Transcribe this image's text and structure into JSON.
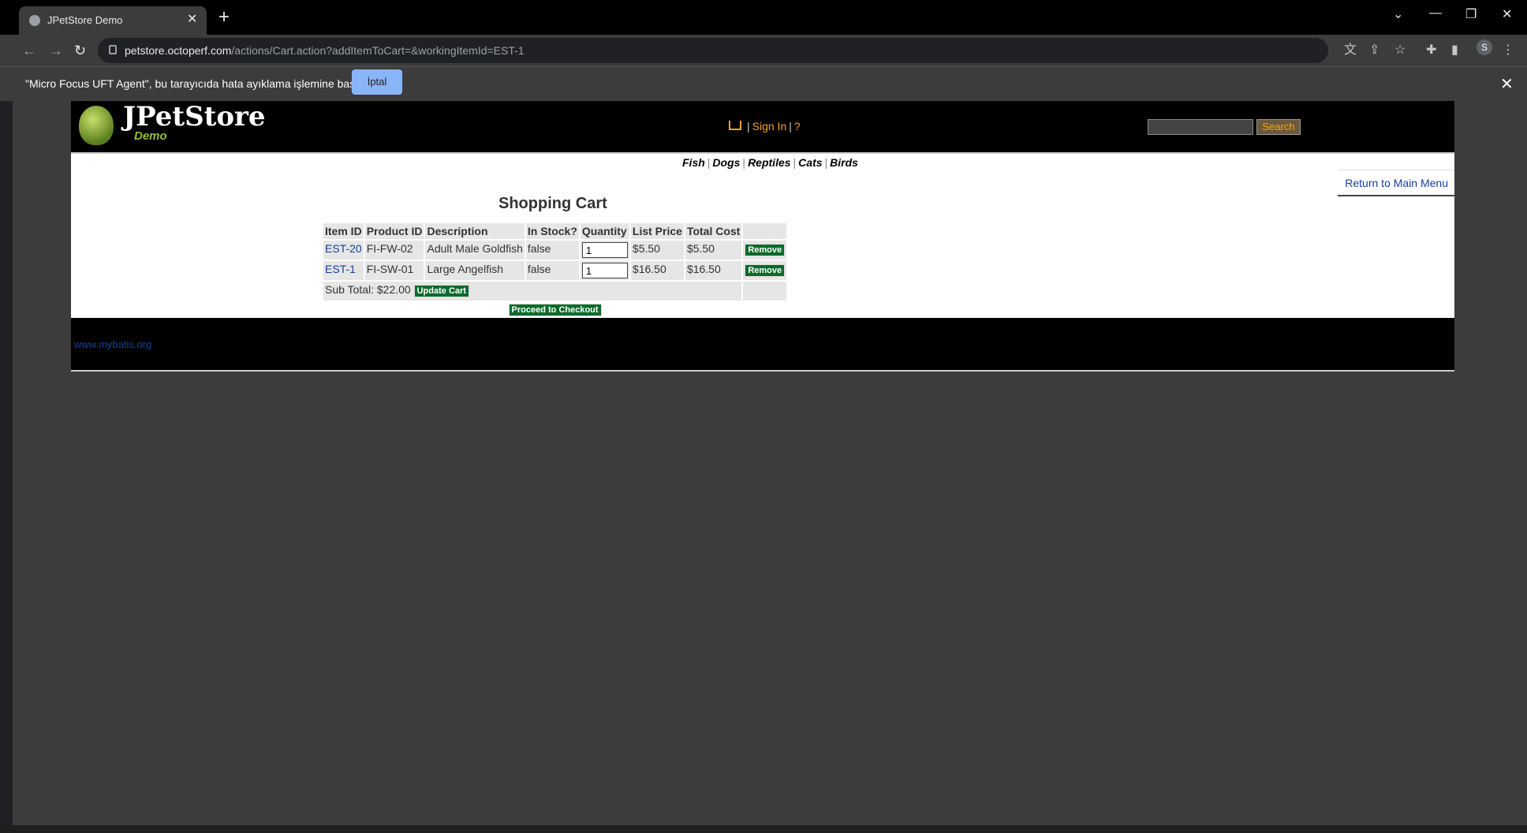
{
  "browser": {
    "tab_title": "JPetStore Demo",
    "url_host": "petstore.octoperf.com",
    "url_path": "/actions/Cart.action?addItemToCart=&workingItemId=EST-1",
    "avatar_letter": "S"
  },
  "infobar": {
    "message": "\"Micro Focus UFT Agent\", bu tarayıcıda hata ayıklama işlemine başladı",
    "cancel_label": "İptal"
  },
  "header": {
    "logo_title": "JPetStore",
    "logo_sub": "Demo",
    "sign_in": "Sign In",
    "help": "?",
    "search_label": "Search"
  },
  "quicklinks": [
    "Fish",
    "Dogs",
    "Reptiles",
    "Cats",
    "Birds"
  ],
  "return_link": "Return to Main Menu",
  "cart": {
    "title": "Shopping Cart",
    "columns": [
      "Item ID",
      "Product ID",
      "Description",
      "In Stock?",
      "Quantity",
      "List Price",
      "Total Cost"
    ],
    "rows": [
      {
        "item_id": "EST-20",
        "product_id": "FI-FW-02",
        "description": "Adult Male Goldfish",
        "in_stock": "false",
        "quantity": "1",
        "list_price": "$5.50",
        "total_cost": "$5.50",
        "remove": "Remove"
      },
      {
        "item_id": "EST-1",
        "product_id": "FI-SW-01",
        "description": "Large Angelfish",
        "in_stock": "false",
        "quantity": "1",
        "list_price": "$16.50",
        "total_cost": "$16.50",
        "remove": "Remove"
      }
    ],
    "subtotal": "Sub Total: $22.00",
    "update_label": "Update Cart",
    "checkout_label": "Proceed to Checkout"
  },
  "footer": {
    "link": "www.mybatis.org"
  }
}
